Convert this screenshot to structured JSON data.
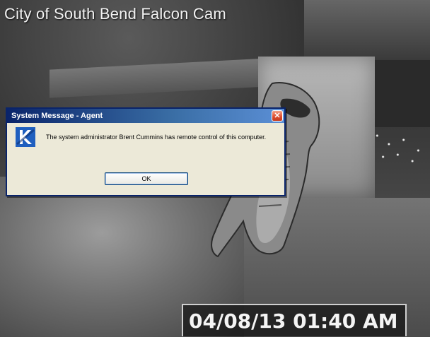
{
  "overlay": {
    "title": "City of South Bend Falcon Cam",
    "timestamp": "04/08/13 01:40 AM"
  },
  "dialog": {
    "title": "System Message - Agent",
    "message": "The system administrator Brent Cummins has remote control of this computer.",
    "ok_label": "OK",
    "close_glyph": "✕",
    "icon_name": "k-logo-icon"
  },
  "colors": {
    "titlebar_start": "#0a246a",
    "titlebar_end": "#5b8fd6",
    "dialog_bg": "#ece9d8",
    "close_red": "#dc4b2c"
  }
}
